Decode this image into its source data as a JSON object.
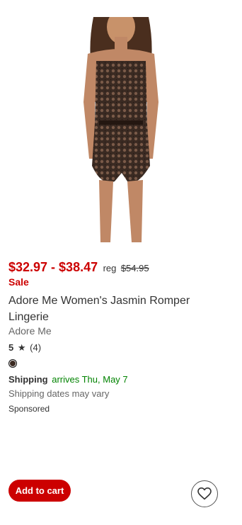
{
  "product": {
    "image_alt": "product-photo",
    "price_range": "$32.97 - $38.47",
    "reg_label": "reg",
    "reg_price": "$54.95",
    "sale_label": "Sale",
    "title": "Adore Me Women's Jasmin Romper Lingerie",
    "brand": "Adore Me",
    "rating_score": "5",
    "rating_star": "★",
    "rating_count": "(4)",
    "swatch_color": "#3b2a22",
    "shipping_label": "Shipping",
    "shipping_date": "arrives Thu, May 7",
    "shipping_note": "Shipping dates may vary",
    "sponsored": "Sponsored"
  },
  "actions": {
    "add_to_cart": "Add to cart",
    "favorite_icon": "heart-icon"
  },
  "colors": {
    "price_red": "#cc0000",
    "shipping_green": "#008300",
    "button_red": "#cc0000"
  }
}
